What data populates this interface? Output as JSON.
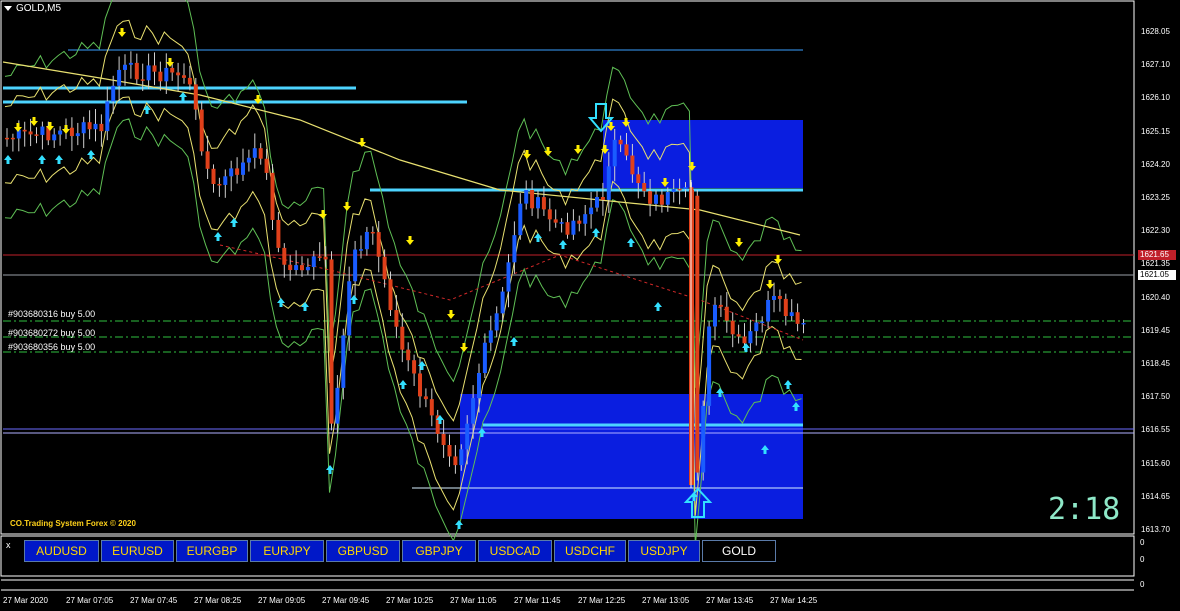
{
  "window": {
    "title": "GOLD,M5"
  },
  "price_axis": {
    "ticks": [
      "1628.05",
      "1627.10",
      "1626.10",
      "1625.15",
      "1624.20",
      "1623.25",
      "1622.30",
      "1621.35",
      "1620.40",
      "1619.45",
      "1618.45",
      "1617.50",
      "1616.55",
      "1615.60",
      "1614.65",
      "1613.70"
    ],
    "current_price": "1621.05",
    "red_line_price": "1621.65"
  },
  "orders": [
    "#903680316 buy 5.00",
    "#903680272 buy 5.00",
    "#903680356 buy 5.00"
  ],
  "copyright": "CO.Trading System Forex © 2020",
  "timer": "2:18",
  "symbols": [
    "AUDUSD",
    "EURUSD",
    "EURGBP",
    "EURJPY",
    "GBPUSD",
    "GBPJPY",
    "USDCAD",
    "USDCHF",
    "USDJPY",
    "GOLD"
  ],
  "active_symbol": "GOLD",
  "subwindow": {
    "close": "x",
    "zero_a": "0",
    "zero_b": "0",
    "zero_c": "0"
  },
  "time_axis": [
    "27 Mar 2020",
    "27 Mar 07:05",
    "27 Mar 07:45",
    "27 Mar 08:25",
    "27 Mar 09:05",
    "27 Mar 09:45",
    "27 Mar 10:25",
    "27 Mar 11:05",
    "27 Mar 11:45",
    "27 Mar 12:25",
    "27 Mar 13:05",
    "27 Mar 13:45",
    "27 Mar 14:25"
  ],
  "colors": {
    "bull": "#1a5cff",
    "bear": "#e0401a",
    "arrow_up": "#33e0ff",
    "arrow_down": "#ffee00",
    "zone": "#0a1ee0",
    "level": "#4dd4ff",
    "band": "#7ed08a",
    "ma": "#e8e070",
    "current": "#c0202a"
  }
}
